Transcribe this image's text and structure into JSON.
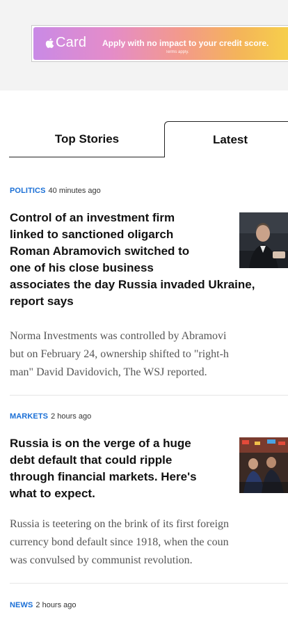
{
  "ad": {
    "brand": "Card",
    "message": "Apply with no impact to your credit score.",
    "terms": "Terms apply."
  },
  "tabs": [
    {
      "label": "Top Stories",
      "selected": false
    },
    {
      "label": "Latest",
      "selected": true
    }
  ],
  "articles": [
    {
      "category": "POLITICS",
      "time": "40 minutes ago",
      "headline_lines": [
        "Control of an investment firm",
        "linked to sanctioned oligarch",
        "Roman Abramovich switched to",
        "one of his close business",
        "associates the day Russia invaded Ukraine,",
        "report says"
      ],
      "summary_lines": [
        "Norma Investments was controlled by Abramovi",
        "but on February 24, ownership shifted to \"right-h",
        "man\" David Davidovich, The WSJ reported."
      ]
    },
    {
      "category": "MARKETS",
      "time": "2 hours ago",
      "headline_lines": [
        "Russia is on the verge of a huge",
        "debt default that could ripple",
        "through financial markets. Here's",
        "what to expect."
      ],
      "summary_lines": [
        "Russia is teetering on the brink of its first foreign",
        "currency bond default since 1918, when the coun",
        "was convulsed by communist revolution."
      ]
    },
    {
      "category": "NEWS",
      "time": "2 hours ago"
    }
  ],
  "colors": {
    "category": "#1a6fd6",
    "ad_gradient_start": "#c98ae6",
    "ad_gradient_end": "#f6d04a"
  }
}
